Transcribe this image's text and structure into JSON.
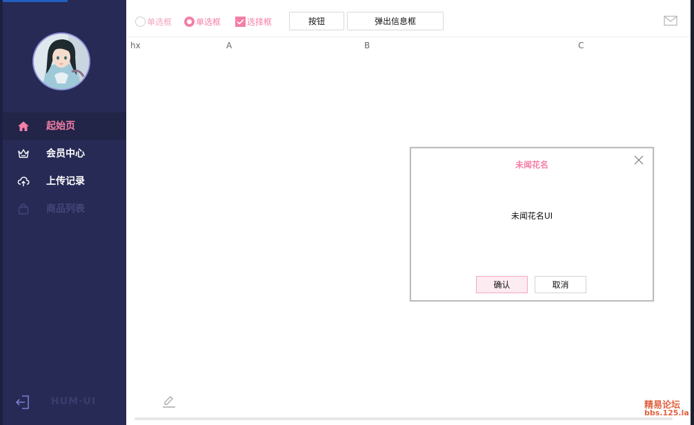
{
  "sidebar": {
    "avatar_icon": "anime-girl-avatar",
    "items": [
      {
        "label": "起始页",
        "icon": "home-icon",
        "state": "active"
      },
      {
        "label": "会员中心",
        "icon": "crown-icon",
        "state": "normal"
      },
      {
        "label": "上传记录",
        "icon": "cloud-upload-icon",
        "state": "normal"
      },
      {
        "label": "商品列表",
        "icon": "shopping-bag-icon",
        "state": "disabled"
      }
    ],
    "footer_brand": "HUM·UI",
    "logout_icon": "logout-icon"
  },
  "toolbar": {
    "radio1_label": "单选框",
    "radio2_label": "单选框",
    "checkbox_label": "选择框",
    "button_label": "按钮",
    "popup_button_label": "弹出信息框",
    "mail_icon": "mail-icon"
  },
  "table": {
    "columns": [
      "hx",
      "A",
      "B",
      "C"
    ]
  },
  "dialog": {
    "title": "未闻花名",
    "message": "未闻花名UI",
    "confirm_label": "确认",
    "cancel_label": "取消"
  },
  "watermark": {
    "line1": "精易论坛",
    "line2": "bbs.125.la"
  },
  "colors": {
    "sidebar_bg": "#272a55",
    "accent_pink": "#f47fa5",
    "watermark": "#e0613f"
  }
}
